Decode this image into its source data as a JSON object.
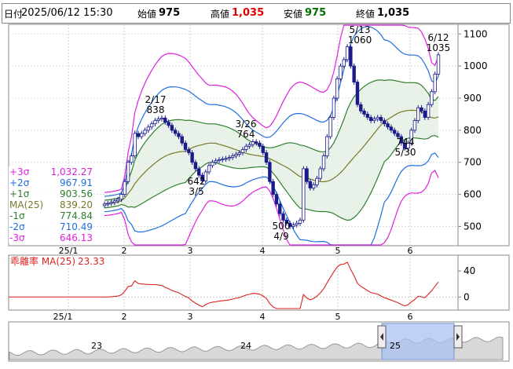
{
  "header": {
    "date_label": "日付",
    "date_value": "2025/06/12 15:30",
    "open_label": "始値",
    "open_value": "975",
    "high_label": "高値",
    "high_value": "1,035",
    "low_label": "安値",
    "low_value": "975",
    "close_label": "終値",
    "close_value": "1,035"
  },
  "colors": {
    "up_candle": "#ffffff",
    "down_candle": "#1a1a8c",
    "ma": "#7a7a2a",
    "sigma1": "#2f7f2f",
    "sigma2": "#1f6fe0",
    "sigma3": "#e020e0",
    "band_fill": "#e8f2e8",
    "deviation_line": "#dd2222",
    "price_text_up": "#e00000",
    "price_text_down": "#007000"
  },
  "legend": [
    {
      "label": "+3σ",
      "value": "1,032.27",
      "color": "#e020e0"
    },
    {
      "label": "+2σ",
      "value": "967.91",
      "color": "#1f6fe0"
    },
    {
      "label": "+1σ",
      "value": "903.56",
      "color": "#2f7f2f"
    },
    {
      "label": "MA(25)",
      "value": "839.20",
      "color": "#7a7a2a"
    },
    {
      "label": "-1σ",
      "value": "774.84",
      "color": "#2f7f2f"
    },
    {
      "label": "-2σ",
      "value": "710.49",
      "color": "#1f6fe0"
    },
    {
      "label": "-3σ",
      "value": "646.13",
      "color": "#e020e0"
    }
  ],
  "deviation_legend": {
    "label": "乖離率 MA(25)",
    "value": "23.33"
  },
  "chart_data": {
    "type": "candlestick",
    "y_ticks": [
      500,
      600,
      700,
      800,
      900,
      1000,
      1100
    ],
    "ylim": [
      440,
      1130
    ],
    "x_month_labels": [
      "25/1",
      "2",
      "3",
      "4",
      "5",
      "6"
    ],
    "deviation_y_ticks": [
      40,
      0
    ],
    "navigator_labels": [
      "25/1",
      "2",
      "3",
      "4",
      "5",
      "6",
      "23",
      "24",
      "25"
    ],
    "annotations": [
      {
        "date": "2/17",
        "value": 838
      },
      {
        "date": "3/5",
        "value": 642
      },
      {
        "date": "3/26",
        "value": 764
      },
      {
        "date": "4/9",
        "value": 500
      },
      {
        "date": "5/13",
        "value": 1060
      },
      {
        "date": "5/30",
        "value": 744
      },
      {
        "date": "6/12",
        "value": 1035
      }
    ],
    "close": [
      570,
      572,
      575,
      580,
      585,
      600,
      640,
      700,
      720,
      790,
      780,
      790,
      800,
      810,
      820,
      830,
      835,
      838,
      825,
      815,
      800,
      790,
      780,
      760,
      740,
      730,
      700,
      680,
      660,
      642,
      670,
      690,
      700,
      705,
      708,
      710,
      712,
      715,
      720,
      725,
      730,
      740,
      750,
      755,
      764,
      760,
      750,
      730,
      700,
      640,
      600,
      570,
      540,
      520,
      510,
      500,
      505,
      510,
      520,
      680,
      640,
      620,
      630,
      650,
      680,
      720,
      780,
      840,
      900,
      960,
      1000,
      1020,
      1060,
      1000,
      950,
      880,
      860,
      850,
      840,
      830,
      835,
      840,
      830,
      820,
      810,
      800,
      790,
      780,
      760,
      744,
      760,
      800,
      830,
      870,
      860,
      840,
      880,
      920,
      975,
      1035
    ]
  }
}
